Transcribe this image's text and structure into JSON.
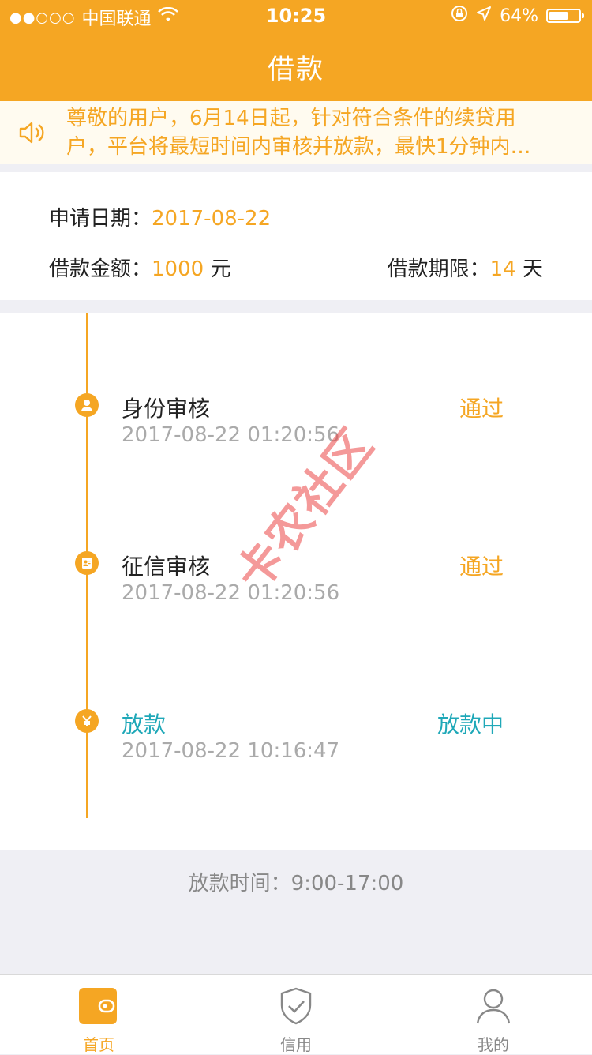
{
  "status_bar": {
    "signal": "●●○○○",
    "carrier": "中国联通",
    "time": "10:25",
    "battery": "64%",
    "battery_level": 0.64
  },
  "nav": {
    "title": "借款"
  },
  "notice": {
    "line1": "尊敬的用户，6月14日起，针对符合条件的续贷用",
    "line2": "户，平台将最短时间内审核并放款，最快1分钟内…"
  },
  "info": {
    "apply_date_label": "申请日期：",
    "apply_date": "2017-08-22",
    "amount_label": "借款金额：",
    "amount": "1000",
    "amount_unit": " 元",
    "term_label": "借款期限：",
    "term": "14",
    "term_unit": " 天"
  },
  "steps": [
    {
      "title": "身份审核",
      "time": "2017-08-22 01:20:56",
      "status": "通过",
      "icon": "user-icon"
    },
    {
      "title": "征信审核",
      "time": "2017-08-22 01:20:56",
      "status": "通过",
      "icon": "contact-card-icon"
    },
    {
      "title": "放款",
      "time": "2017-08-22 10:16:47",
      "status": "放款中",
      "icon": "yen-icon"
    }
  ],
  "watermark": "卡农社区",
  "loan_time": "放款时间：9:00-17:00",
  "tabs": [
    {
      "label": "首页",
      "icon": "wallet-icon",
      "active": true
    },
    {
      "label": "信用",
      "icon": "shield-check-icon",
      "active": false
    },
    {
      "label": "我的",
      "icon": "person-icon",
      "active": false
    }
  ],
  "colors": {
    "accent": "#f5a623",
    "teal": "#1fa8b8",
    "watermark": "#eb4646"
  }
}
